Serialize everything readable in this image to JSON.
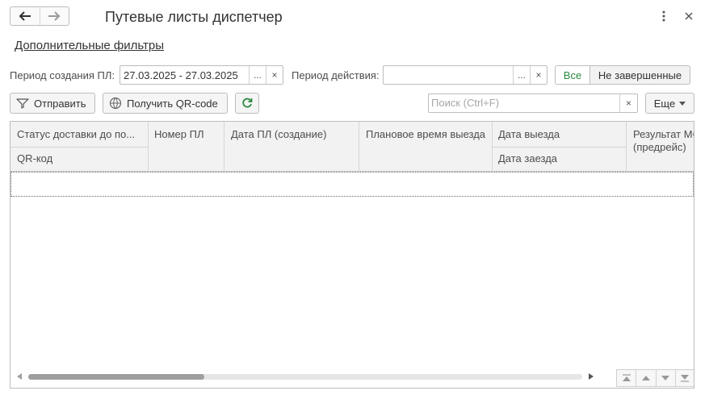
{
  "window": {
    "title": "Путевые листы диспетчер"
  },
  "filters": {
    "link_label": "Дополнительные фильтры",
    "created_label": "Период создания ПЛ:",
    "created_value": "27.03.2025 - 27.03.2025",
    "action_label": "Период действия:",
    "action_value": "",
    "select_btn": "...",
    "clear_btn": "×",
    "toggle_all": "Все",
    "toggle_not_completed": "Не завершенные"
  },
  "toolbar": {
    "send_label": "Отправить",
    "qr_label": "Получить QR-code",
    "search_placeholder": "Поиск (Ctrl+F)",
    "more_label": "Еще"
  },
  "table": {
    "columns": {
      "status": "Статус доставки до по...",
      "qr": "QR-код",
      "number": "Номер ПЛ",
      "date_created": "Дата ПЛ (создание)",
      "planned_departure": "Плановое время выезда",
      "departure_date": "Дата выезда",
      "arrival_date": "Дата заезда",
      "result_line1": "Результат МО",
      "result_line2": "(предрейс)"
    }
  },
  "scrollbar": {
    "horizontal_position": 0.0,
    "visible_fraction": 0.32
  },
  "colors": {
    "accent_green": "#2b8a3e",
    "header_bg": "#f2f2f2",
    "border": "#bdbdbd"
  }
}
